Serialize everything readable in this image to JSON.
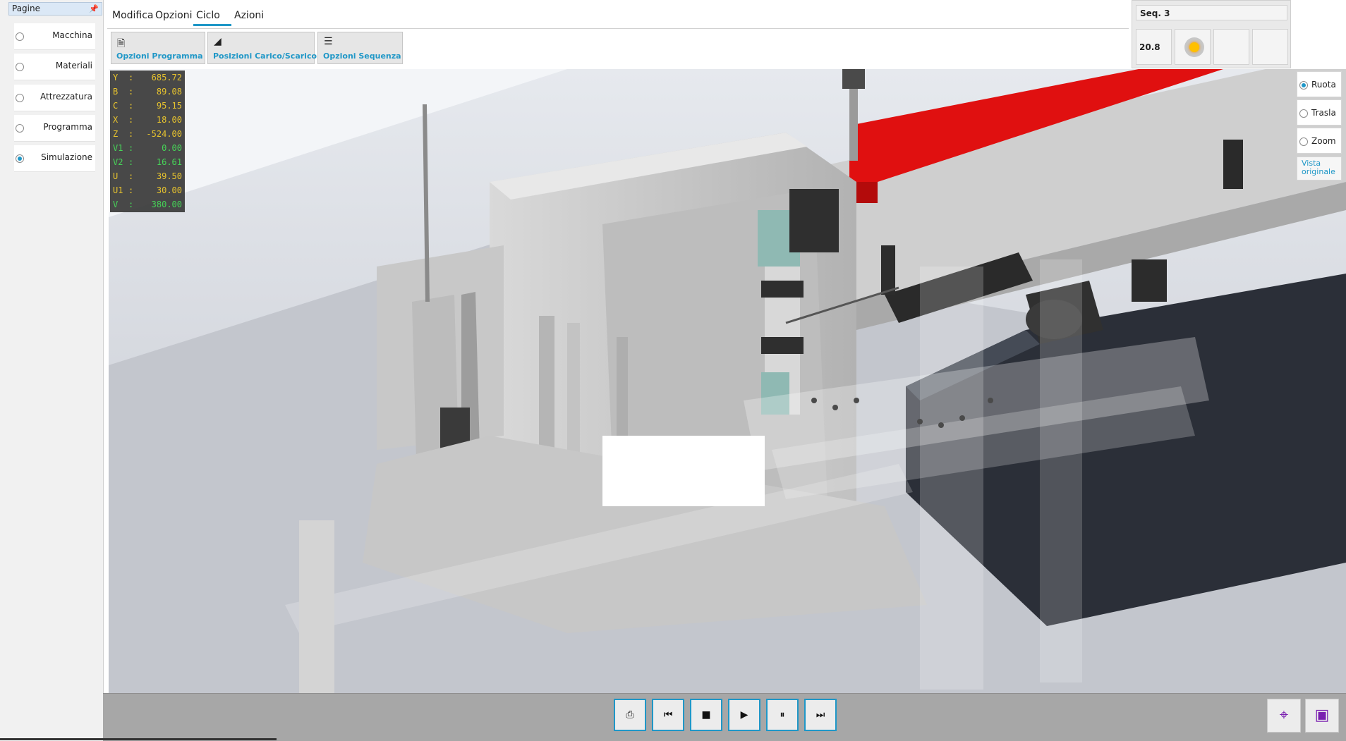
{
  "left_panel": {
    "title": "Pagine",
    "pin_icon": "pin-icon",
    "items": [
      {
        "label": "Macchina",
        "selected": false
      },
      {
        "label": "Materiali",
        "selected": false
      },
      {
        "label": "Attrezzatura",
        "selected": false
      },
      {
        "label": "Programma",
        "selected": false
      },
      {
        "label": "Simulazione",
        "selected": true
      }
    ]
  },
  "tabs": [
    {
      "label": "Modifica",
      "active": false
    },
    {
      "label": "Opzioni",
      "active": false
    },
    {
      "label": "Ciclo",
      "active": true
    },
    {
      "label": "Azioni",
      "active": false
    }
  ],
  "toolbar": [
    {
      "label": "Opzioni Programma",
      "icon": "program-options-icon"
    },
    {
      "label": "Posizioni Carico/Scarico",
      "icon": "load-unload-icon"
    },
    {
      "label": "Opzioni Sequenza",
      "icon": "sequence-options-icon"
    }
  ],
  "sequence": {
    "label": "Seq. 3",
    "value": "20.8",
    "status_color": "#ffc000"
  },
  "readout": [
    {
      "name": "Y",
      "value": "685.72",
      "color": "yellow"
    },
    {
      "name": "B",
      "value": "89.08",
      "color": "yellow"
    },
    {
      "name": "C",
      "value": "95.15",
      "color": "yellow"
    },
    {
      "name": "X",
      "value": "18.00",
      "color": "yellow"
    },
    {
      "name": "Z",
      "value": "-524.00",
      "color": "yellow"
    },
    {
      "name": "V1",
      "value": "0.00",
      "color": "green"
    },
    {
      "name": "V2",
      "value": "16.61",
      "color": "green"
    },
    {
      "name": "U",
      "value": "39.50",
      "color": "yellow"
    },
    {
      "name": "U1",
      "value": "30.00",
      "color": "yellow"
    },
    {
      "name": "V",
      "value": "380.00",
      "color": "green"
    }
  ],
  "view_controls": {
    "options": [
      {
        "label": "Ruota",
        "selected": true
      },
      {
        "label": "Trasla",
        "selected": false
      },
      {
        "label": "Zoom",
        "selected": false
      }
    ],
    "reset_line1": "Vista",
    "reset_line2": "originale"
  },
  "playback": {
    "buttons": [
      "save-icon",
      "skip-back-icon",
      "stop-icon",
      "play-icon",
      "pause-icon",
      "skip-forward-icon"
    ],
    "glyphs": [
      "⎙",
      "⏮",
      "■",
      "▶",
      "⏸",
      "⏭"
    ]
  },
  "corner_buttons": [
    "crosshair-icon",
    "cube-icon"
  ],
  "colors": {
    "accent": "#1f97c7",
    "highlight_part": "#e01010"
  }
}
